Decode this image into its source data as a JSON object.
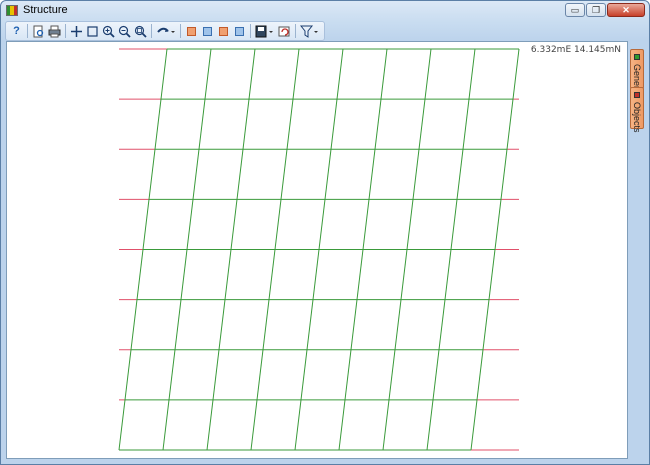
{
  "window": {
    "title": "Structure",
    "icon_colors": [
      "#2f8f2f",
      "#e6c200",
      "#c0302a"
    ],
    "controls": {
      "minimize_icon": "minimize-icon",
      "maximize_icon": "maximize-icon",
      "close_icon": "close-icon",
      "minimize_glyph": "▭",
      "maximize_glyph": "❐",
      "close_glyph": "✕"
    }
  },
  "toolbar": {
    "help_glyph": "?",
    "items": [
      {
        "name": "help-icon"
      },
      {
        "name": "print-preview-icon"
      },
      {
        "name": "print-icon"
      },
      {
        "name": "pan-icon"
      },
      {
        "name": "rectangle-select-icon"
      },
      {
        "name": "zoom-in-icon"
      },
      {
        "name": "zoom-out-icon"
      },
      {
        "name": "zoom-extents-icon"
      },
      {
        "name": "undo-icon"
      },
      {
        "name": "layer-icon-1"
      },
      {
        "name": "layer-icon-2"
      },
      {
        "name": "layer-icon-3"
      },
      {
        "name": "layer-icon-4"
      },
      {
        "name": "save-image-icon"
      },
      {
        "name": "refresh-icon"
      },
      {
        "name": "filter-icon"
      }
    ]
  },
  "canvas": {
    "coordinate_readout": "6.332mE 14.145mN",
    "grid_color": "#3a9a3a",
    "stub_color": "#e0506a",
    "grid": {
      "columns": 8,
      "rows": 8
    }
  },
  "side_panel": {
    "tabs": [
      {
        "label": "General",
        "marker_color": "#2f9a2f"
      },
      {
        "label": "Objects",
        "marker_color": "#c0302a"
      }
    ]
  }
}
